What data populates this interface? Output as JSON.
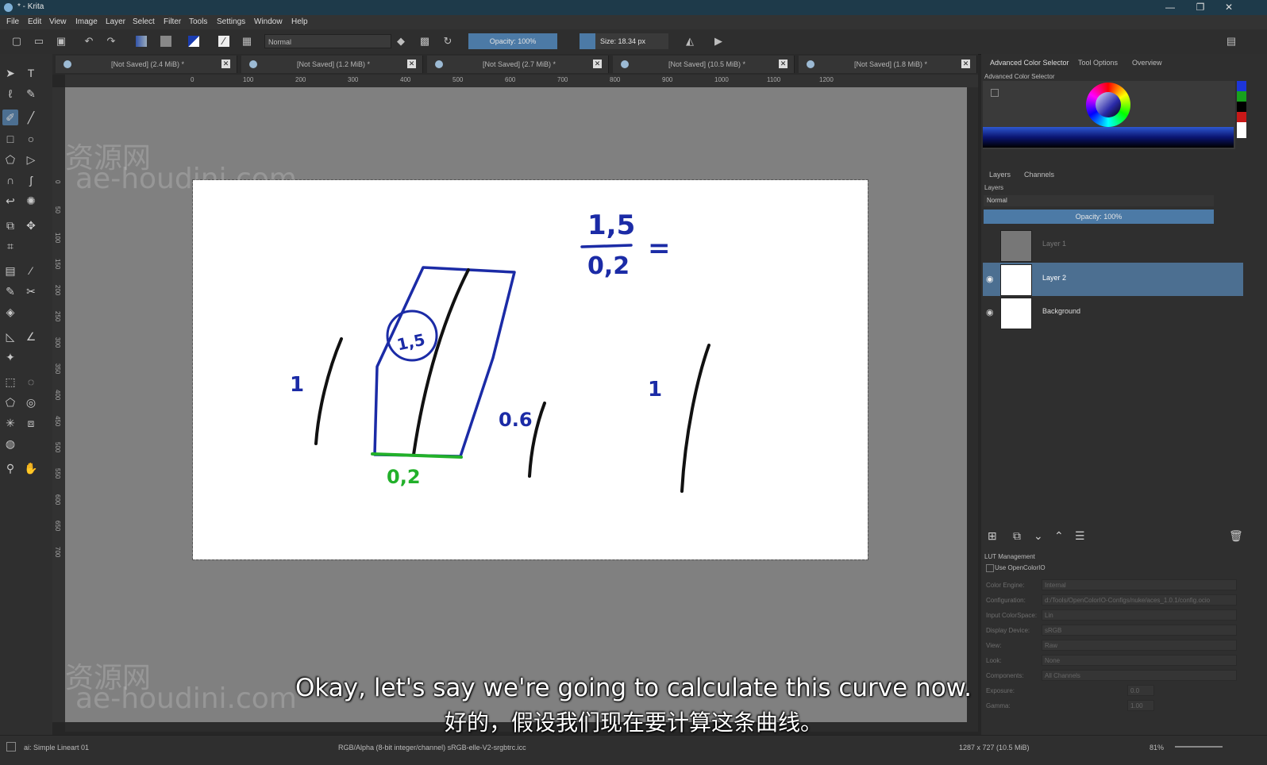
{
  "window": {
    "title": "* - Krita",
    "minimize": "—",
    "maximize": "❐",
    "close": "✕"
  },
  "menu": [
    "File",
    "Edit",
    "View",
    "Image",
    "Layer",
    "Select",
    "Filter",
    "Tools",
    "Settings",
    "Window",
    "Help"
  ],
  "toolbar": {
    "blend_mode": "Normal",
    "opacity": "Opacity: 100%",
    "size": "Size: 18.34 px",
    "size_fraction": 0.18
  },
  "tabs": [
    {
      "label": "[Not Saved]  (2.4 MiB) *"
    },
    {
      "label": "[Not Saved]  (1.2 MiB) *"
    },
    {
      "label": "[Not Saved]  (2.7 MiB) *"
    },
    {
      "label": "[Not Saved]  (10.5 MiB) *"
    },
    {
      "label": "[Not Saved]  (1.8 MiB) *"
    }
  ],
  "ruler": {
    "h": [
      "0",
      "100",
      "200",
      "300",
      "400",
      "500",
      "600",
      "700",
      "800",
      "900",
      "1000",
      "1100",
      "1200"
    ],
    "v": [
      "0",
      "50",
      "100",
      "150",
      "200",
      "250",
      "300",
      "350",
      "400",
      "450",
      "500",
      "550",
      "600",
      "650",
      "700"
    ]
  },
  "watermark": {
    "line1": "资源网",
    "line2": "ae-houdini.com"
  },
  "drawing": {
    "f_num": "1,5",
    "f_den": "0,2",
    "eq": "=",
    "label_left": "1",
    "label_width": "0,2",
    "label_mid": "0.6",
    "label_right": "1",
    "circle_text": "1,5"
  },
  "subtitles": {
    "en": "Okay, let's say we're going to calculate this curve now.",
    "zh": "好的，假设我们现在要计算这条曲线。"
  },
  "dock": {
    "tabs": [
      "Advanced Color Selector",
      "Tool Options",
      "Overview"
    ],
    "color_title": "Advanced Color Selector",
    "layer_tabs": [
      "Layers",
      "Channels"
    ],
    "layers_title": "Layers",
    "blend": "Normal",
    "opacity": "Opacity:  100%",
    "layers": [
      {
        "name": "Layer 1"
      },
      {
        "name": "Layer 2"
      },
      {
        "name": "Background"
      }
    ],
    "lut_title": "LUT Management",
    "lut_checkbox": "Use OpenColorIO",
    "lut_rows": [
      {
        "label": "Color Engine:",
        "value": "Internal"
      },
      {
        "label": "Configuration:",
        "value": "d:/Tools/OpenColorIO-Configs/nuke/aces_1.0.1/config.ocio"
      },
      {
        "label": "Input ColorSpace:",
        "value": "Lin"
      },
      {
        "label": "Display Device:",
        "value": "sRGB"
      },
      {
        "label": "View:",
        "value": "Raw"
      },
      {
        "label": "Look:",
        "value": "None"
      },
      {
        "label": "Components:",
        "value": "All Channels"
      },
      {
        "label": "Exposure:",
        "value": "0.0"
      },
      {
        "label": "Gamma:",
        "value": "1.00"
      }
    ]
  },
  "status": {
    "left": "ai: Simple Lineart 01",
    "middle": "RGB/Alpha (8-bit integer/channel)  sRGB-elle-V2-srgbtrc.icc",
    "dims": "1287 x 727 (10.5 MiB)",
    "zoom": "81%"
  }
}
